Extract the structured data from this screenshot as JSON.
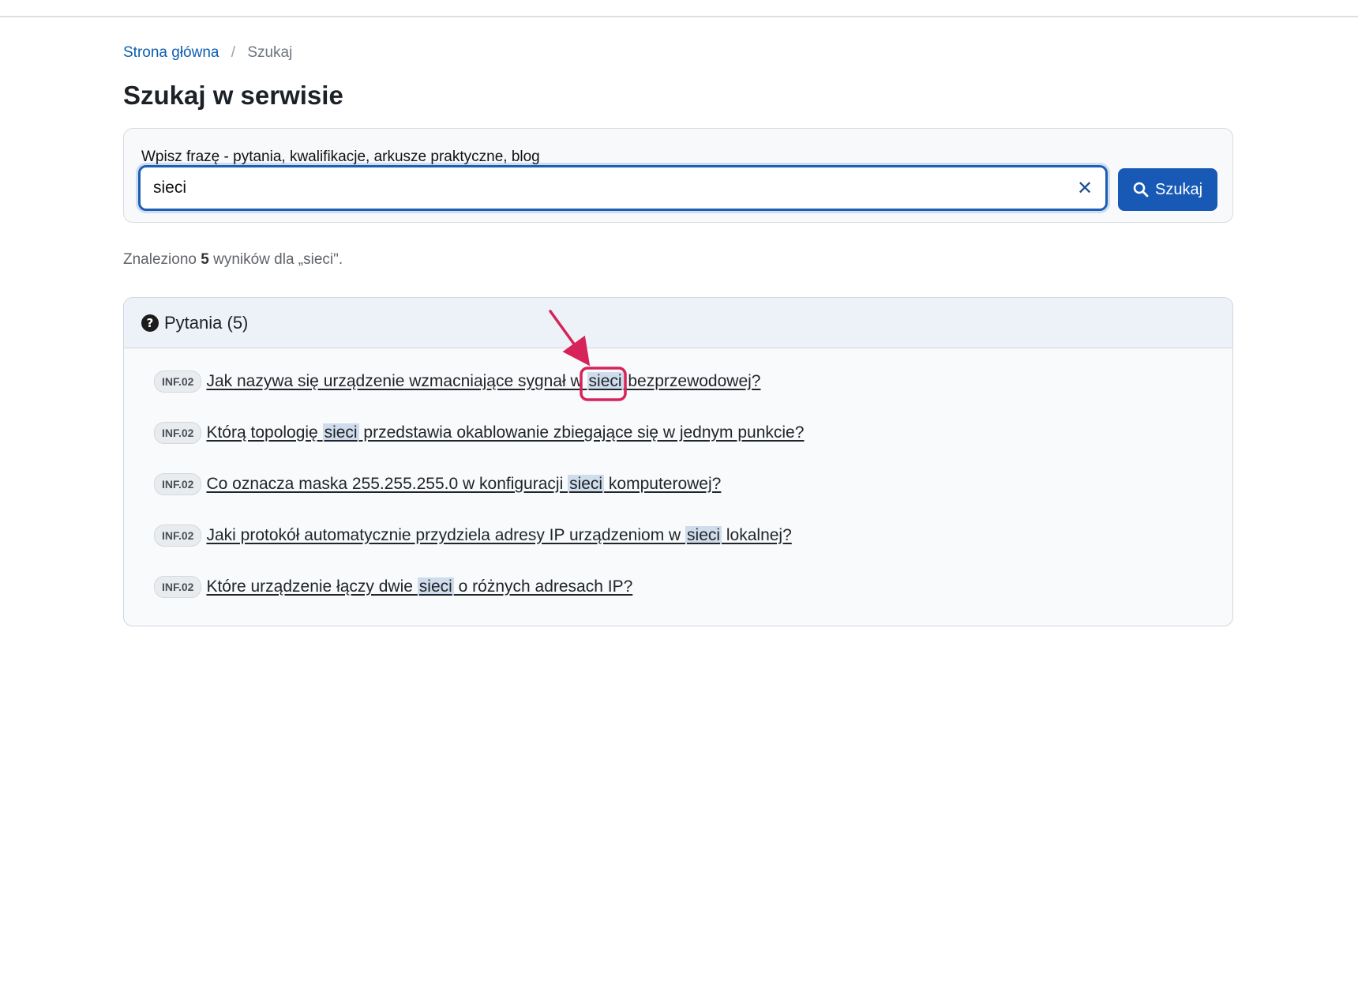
{
  "breadcrumb": {
    "home": "Strona główna",
    "separator": "/",
    "current": "Szukaj"
  },
  "page_title": "Szukaj w serwisie",
  "search": {
    "label": "Wpisz frazę - pytania, kwalifikacje, arkusze praktyczne, blog",
    "value": "sieci",
    "clear_symbol": "✕",
    "button_label": "Szukaj"
  },
  "summary": {
    "prefix": "Znaleziono ",
    "count": "5",
    "suffix": " wyników dla „sieci\"."
  },
  "results": {
    "title": "Pytania (5)",
    "icon_symbol": "?",
    "items": [
      {
        "badge": "INF.02",
        "before": "Jak nazywa się urządzenie wzmacniające sygnał w ",
        "match": "sieci",
        "after": " bezprzewodowej?"
      },
      {
        "badge": "INF.02",
        "before": "Którą topologię ",
        "match": "sieci",
        "after": " przedstawia okablowanie zbiegające się w jednym punkcie?"
      },
      {
        "badge": "INF.02",
        "before": "Co oznacza maska 255.255.255.0 w konfiguracji ",
        "match": "sieci",
        "after": " komputerowej?"
      },
      {
        "badge": "INF.02",
        "before": "Jaki protokół automatycznie przydziela adresy IP urządzeniom w ",
        "match": "sieci",
        "after": " lokalnej?"
      },
      {
        "badge": "INF.02",
        "before": "Które urządzenie łączy dwie ",
        "match": "sieci",
        "after": " o różnych adresach IP?"
      }
    ]
  },
  "colors": {
    "primary": "#1759b4",
    "link": "#0d5fb0",
    "highlight": "#cfdcec",
    "annotation": "#d6235a"
  }
}
